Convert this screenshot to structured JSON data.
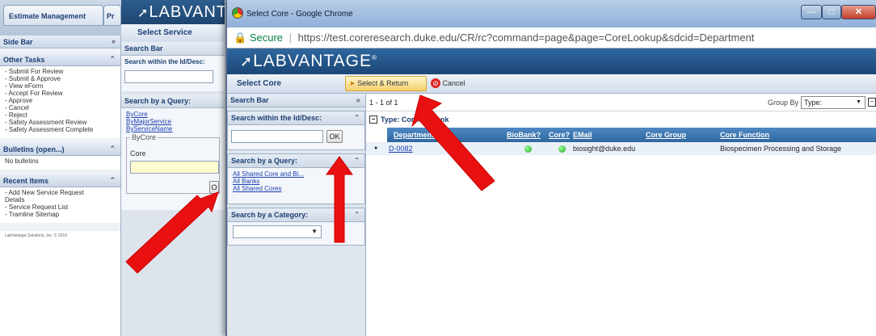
{
  "background_app": {
    "tabs": [
      "Estimate Management",
      "Pr"
    ],
    "logo": "LABVANT",
    "select_service": "Select Service",
    "sidebar_title": "Side Bar",
    "sidebar_collapse": "«",
    "other_tasks_title": "Other Tasks",
    "other_tasks": [
      "- Submit For Review",
      "- Submit & Approve",
      "- View eForm",
      "- Accept For Review",
      "- Approve",
      "- Cancel",
      "- Reject",
      "- Safety Assessment Review",
      "- Safety Assessment Complete"
    ],
    "bulletins_title": "Bulletins (open...)",
    "bulletins_text": "No bulletins",
    "recent_items_title": "Recent Items",
    "recent_items": [
      "- Add New Service Request",
      "  Details",
      "- Service Request List",
      "- Tramline Sitemap"
    ],
    "copyright": "LabVantage Solutions, Inc. © 2016",
    "search_bar": "Search Bar",
    "search_within": "Search within the Id/Desc:",
    "search_query": "Search by a Query:",
    "query_links": [
      "ByCore",
      "ByMajorService",
      "ByServiceName"
    ],
    "bycore_legend": "ByCore",
    "core_label": "Core",
    "go_btn": "O"
  },
  "window": {
    "title": "Select Core - Google Chrome",
    "secure": "Secure",
    "url": "https://test.coreresearch.duke.edu/CR/rc?command=page&page=CoreLookup&sdcid=Department"
  },
  "app": {
    "logo": "LABVANTAGE",
    "logo_mark": "®",
    "page_title": "Select Core",
    "select_return": "Select & Return",
    "cancel": "Cancel",
    "search_bar": "Search Bar",
    "search_bar_ctl": "«",
    "search_within": "Search within the Id/Desc:",
    "ok_btn": "OK",
    "search_query": "Search by a Query:",
    "query_links": [
      "All Shared Core and Bi...",
      "All Banks",
      "All Shared Cores"
    ],
    "search_category": "Search by a Category:",
    "paging": "1 - 1 of 1",
    "group_by_label": "Group By",
    "group_by_value": "Type:",
    "group_header": "Type: Core/B",
    "group_header_tail": "nk",
    "columns": [
      "Department I",
      "BioBank?",
      "Core?",
      "EMail",
      "Core Group",
      "Core Function"
    ],
    "rows": [
      {
        "id": "D-0082",
        "email": "biosight@duke.edu",
        "core_group": "",
        "core_function": "Biospecimen Processing and Storage"
      }
    ]
  },
  "colors": {
    "arrow": "#e81010",
    "header_blue": "#2f679e"
  }
}
